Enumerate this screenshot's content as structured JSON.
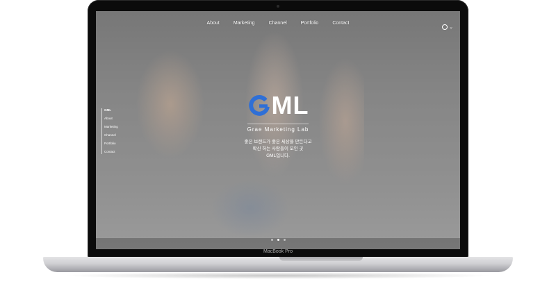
{
  "device": {
    "model_label": "MacBook Pro"
  },
  "nav": {
    "items": [
      "About",
      "Marketing",
      "Channel",
      "Portfolio",
      "Contact"
    ]
  },
  "side_nav": {
    "items": [
      "GML",
      "About",
      "Marketing",
      "Channel",
      "Portfolio",
      "Contact"
    ],
    "active": "GML"
  },
  "hero": {
    "logo_letters": "ML",
    "tagline": "Grae Marketing Lab",
    "copy_lines": [
      "좋은 브랜드가 좋은 세상을 만든다고",
      "확신 하는 사람들이 모인 곳",
      "GML입니다."
    ]
  },
  "slider": {
    "count": 3,
    "active_index": 1
  },
  "icons": {
    "language": "globe-icon",
    "dropdown": "chevron-down-icon"
  },
  "colors": {
    "logo_accent": "#2f6fd6",
    "logo_text": "#ffffff"
  }
}
